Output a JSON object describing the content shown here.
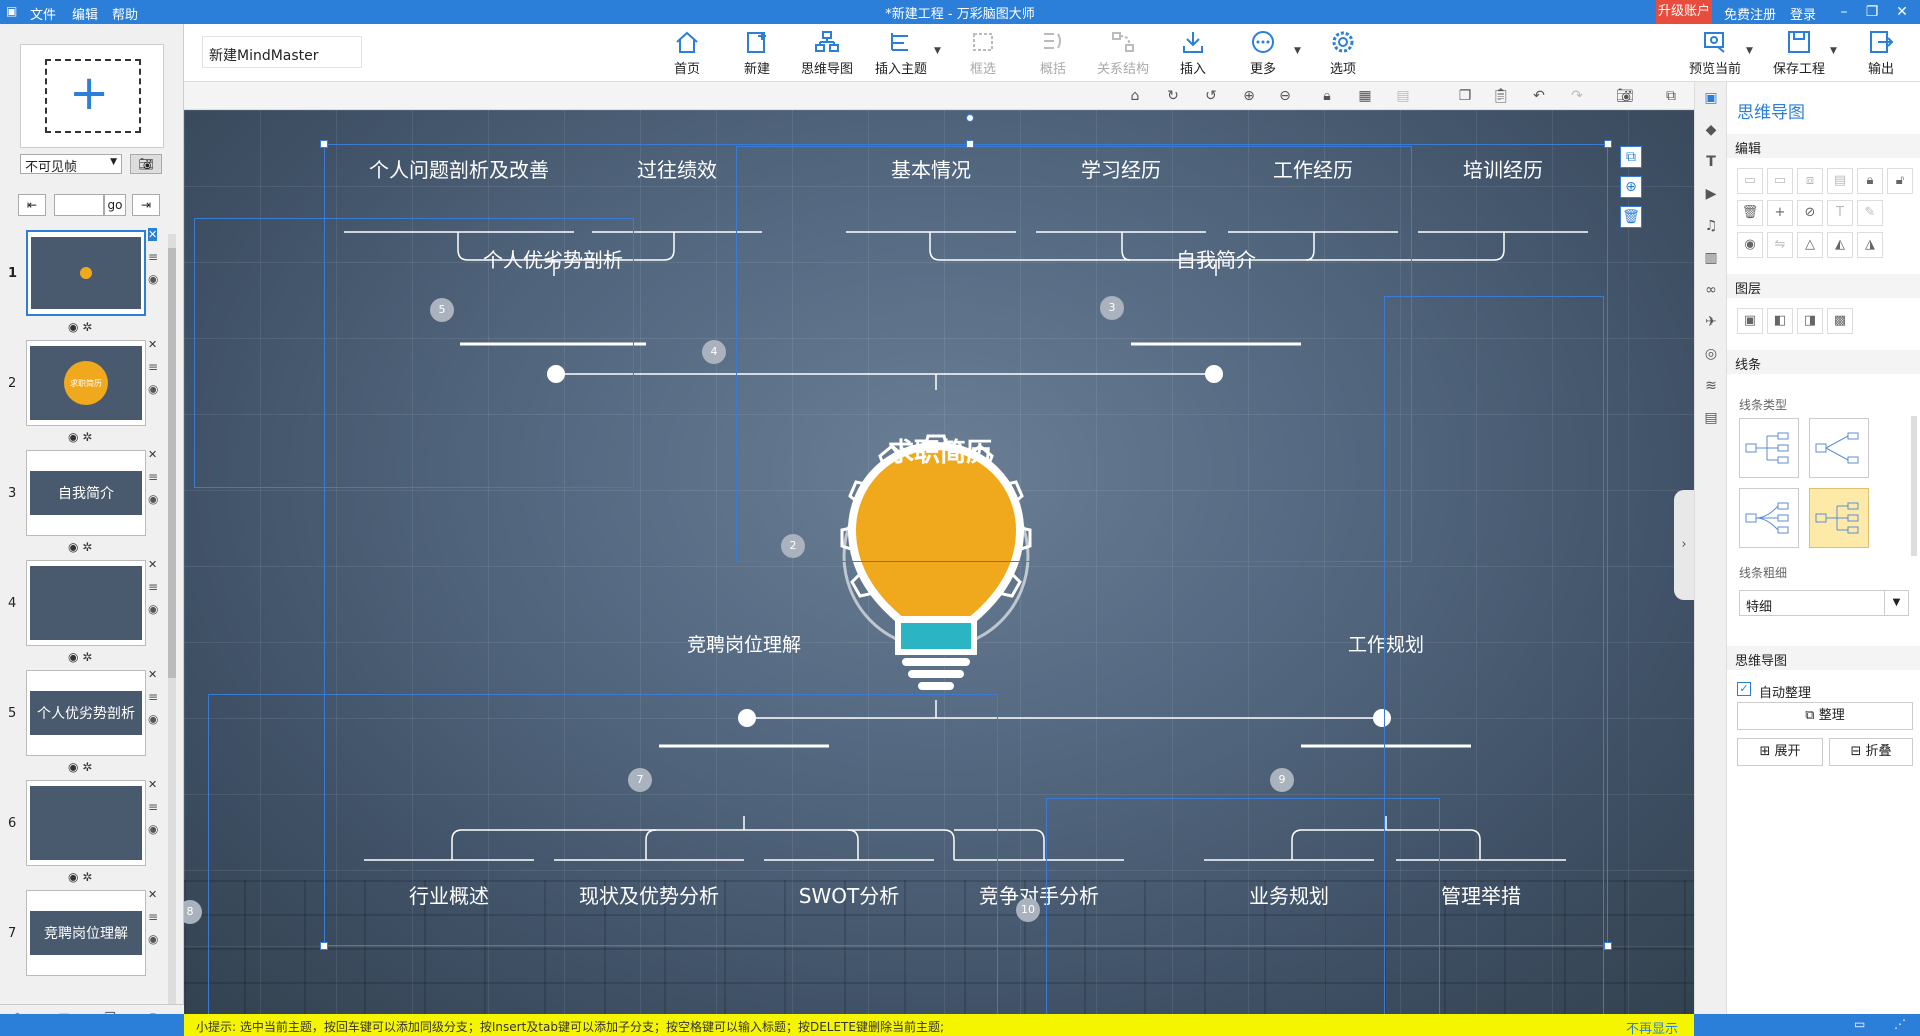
{
  "titlebar": {
    "menus": [
      "文件",
      "编辑",
      "帮助"
    ],
    "title": "*新建工程 - 万彩脑图大师",
    "upgrade": "升级账户",
    "register": "免费注册",
    "login": "登录"
  },
  "toolbar": {
    "doc_name": "新建MindMaster",
    "buttons": {
      "home": "首页",
      "new": "新建",
      "mindmap": "思维导图",
      "insert_topic": "插入主题",
      "frame": "框选",
      "summary": "概括",
      "relation": "关系结构",
      "insert": "插入",
      "more": "更多",
      "options": "选项",
      "preview": "预览当前",
      "save": "保存工程",
      "export": "输出"
    }
  },
  "left_panel": {
    "visibility": "不可见帧",
    "go": "go",
    "slides": [
      {
        "num": "1",
        "label": ""
      },
      {
        "num": "2",
        "label": "求职简历"
      },
      {
        "num": "3",
        "label": "自我简介"
      },
      {
        "num": "4",
        "label": ""
      },
      {
        "num": "5",
        "label": "个人优劣势剖析"
      },
      {
        "num": "6",
        "label": ""
      },
      {
        "num": "7",
        "label": "竞聘岗位理解"
      }
    ]
  },
  "mindmap": {
    "center": "求职简历",
    "branches": {
      "self_intro": "自我简介",
      "pros_cons": "个人优劣势剖析",
      "position": "竞聘岗位理解",
      "work_plan": "工作规划"
    },
    "leaves": {
      "basic": "基本情况",
      "study": "学习经历",
      "work": "工作经历",
      "training": "培训经历",
      "problems": "个人问题剖析及改善",
      "past_perf": "过往绩效",
      "industry": "行业概述",
      "status": "现状及优势分析",
      "swot": "SWOT分析",
      "competitor": "竞争对手分析",
      "biz_plan": "业务规划",
      "measures": "管理举措"
    },
    "badges": [
      "2",
      "3",
      "4",
      "5",
      "7",
      "8",
      "9",
      "10"
    ]
  },
  "right_panel": {
    "title": "思维导图",
    "edit": "编辑",
    "layer": "图层",
    "lines": "线条",
    "line_type": "线条类型",
    "line_thickness": "线条粗细",
    "thickness_value": "特细",
    "mindmap_sec": "思维导图",
    "auto_arrange": "自动整理",
    "arrange": "整理",
    "expand": "展开",
    "collapse": "折叠"
  },
  "status": {
    "hint": "小提示: 选中当前主题，按回车键可以添加同级分支；按Insert及tab键可以添加子分支；按空格键可以输入标题；按DELETE键删除当前主题;",
    "no_more": "不再显示"
  },
  "colors": {
    "accent": "#2b7fd9",
    "bulb": "#f0a81c",
    "bulb_base": "#2bb5c4",
    "hint_bar": "#f5f500",
    "upgrade": "#e74c3c"
  }
}
